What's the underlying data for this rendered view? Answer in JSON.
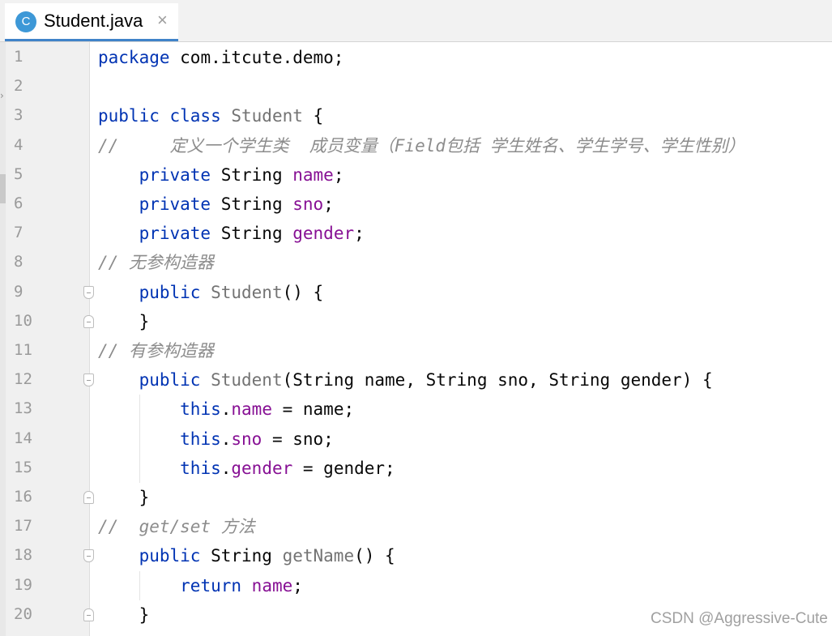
{
  "tab": {
    "icon_letter": "C",
    "label": "Student.java",
    "close": "×"
  },
  "gutter": {
    "line_numbers": [
      "1",
      "2",
      "3",
      "4",
      "5",
      "6",
      "7",
      "8",
      "9",
      "10",
      "11",
      "12",
      "13",
      "14",
      "15",
      "16",
      "17",
      "18",
      "19",
      "20"
    ],
    "fold_markers": [
      {
        "line": 9,
        "kind": "start"
      },
      {
        "line": 10,
        "kind": "end"
      },
      {
        "line": 12,
        "kind": "start"
      },
      {
        "line": 16,
        "kind": "end"
      },
      {
        "line": 18,
        "kind": "start"
      },
      {
        "line": 20,
        "kind": "end"
      }
    ]
  },
  "code": {
    "lines": [
      [
        {
          "t": "package",
          "k": "kw"
        },
        {
          "t": " com.itcute.demo;",
          "k": "plain"
        }
      ],
      [],
      [
        {
          "t": "public class",
          "k": "kw"
        },
        {
          "t": " ",
          "k": "plain"
        },
        {
          "t": "Student",
          "k": "decl"
        },
        {
          "t": " {",
          "k": "plain"
        }
      ],
      [
        {
          "t": "//     定义一个学生类  成员变量（Field包括 学生姓名、学生学号、学生性别）",
          "k": "cmt"
        }
      ],
      [
        {
          "t": "    ",
          "k": "plain"
        },
        {
          "t": "private",
          "k": "kw"
        },
        {
          "t": " String ",
          "k": "plain"
        },
        {
          "t": "name",
          "k": "fld"
        },
        {
          "t": ";",
          "k": "plain"
        }
      ],
      [
        {
          "t": "    ",
          "k": "plain"
        },
        {
          "t": "private",
          "k": "kw"
        },
        {
          "t": " String ",
          "k": "plain"
        },
        {
          "t": "sno",
          "k": "fld"
        },
        {
          "t": ";",
          "k": "plain"
        }
      ],
      [
        {
          "t": "    ",
          "k": "plain"
        },
        {
          "t": "private",
          "k": "kw"
        },
        {
          "t": " String ",
          "k": "plain"
        },
        {
          "t": "gender",
          "k": "fld"
        },
        {
          "t": ";",
          "k": "plain"
        }
      ],
      [
        {
          "t": "// 无参构造器",
          "k": "cmt"
        }
      ],
      [
        {
          "t": "    ",
          "k": "plain"
        },
        {
          "t": "public",
          "k": "kw"
        },
        {
          "t": " ",
          "k": "plain"
        },
        {
          "t": "Student",
          "k": "decl"
        },
        {
          "t": "() {",
          "k": "plain"
        }
      ],
      [
        {
          "t": "    }",
          "k": "plain"
        }
      ],
      [
        {
          "t": "// 有参构造器",
          "k": "cmt"
        }
      ],
      [
        {
          "t": "    ",
          "k": "plain"
        },
        {
          "t": "public",
          "k": "kw"
        },
        {
          "t": " ",
          "k": "plain"
        },
        {
          "t": "Student",
          "k": "decl"
        },
        {
          "t": "(String name, String sno, String gender) {",
          "k": "plain"
        }
      ],
      [
        {
          "t": "        ",
          "k": "plain"
        },
        {
          "t": "this",
          "k": "kw"
        },
        {
          "t": ".",
          "k": "plain"
        },
        {
          "t": "name",
          "k": "fld"
        },
        {
          "t": " = name;",
          "k": "plain"
        }
      ],
      [
        {
          "t": "        ",
          "k": "plain"
        },
        {
          "t": "this",
          "k": "kw"
        },
        {
          "t": ".",
          "k": "plain"
        },
        {
          "t": "sno",
          "k": "fld"
        },
        {
          "t": " = sno;",
          "k": "plain"
        }
      ],
      [
        {
          "t": "        ",
          "k": "plain"
        },
        {
          "t": "this",
          "k": "kw"
        },
        {
          "t": ".",
          "k": "plain"
        },
        {
          "t": "gender",
          "k": "fld"
        },
        {
          "t": " = gender;",
          "k": "plain"
        }
      ],
      [
        {
          "t": "    }",
          "k": "plain"
        }
      ],
      [
        {
          "t": "//  get/set 方法",
          "k": "cmt"
        }
      ],
      [
        {
          "t": "    ",
          "k": "plain"
        },
        {
          "t": "public",
          "k": "kw"
        },
        {
          "t": " String ",
          "k": "plain"
        },
        {
          "t": "getName",
          "k": "decl"
        },
        {
          "t": "() {",
          "k": "plain"
        }
      ],
      [
        {
          "t": "        ",
          "k": "plain"
        },
        {
          "t": "return",
          "k": "kw"
        },
        {
          "t": " ",
          "k": "plain"
        },
        {
          "t": "name",
          "k": "fld"
        },
        {
          "t": ";",
          "k": "plain"
        }
      ],
      [
        {
          "t": "    }",
          "k": "plain"
        }
      ]
    ]
  },
  "watermark": "CSDN @Aggressive-Cute",
  "colors": {
    "keyword": "#0033b3",
    "field": "#871094",
    "comment": "#8c8c8c",
    "declaration": "#737373",
    "tab_accent": "#4083c9",
    "class_icon": "#3d98d7"
  }
}
